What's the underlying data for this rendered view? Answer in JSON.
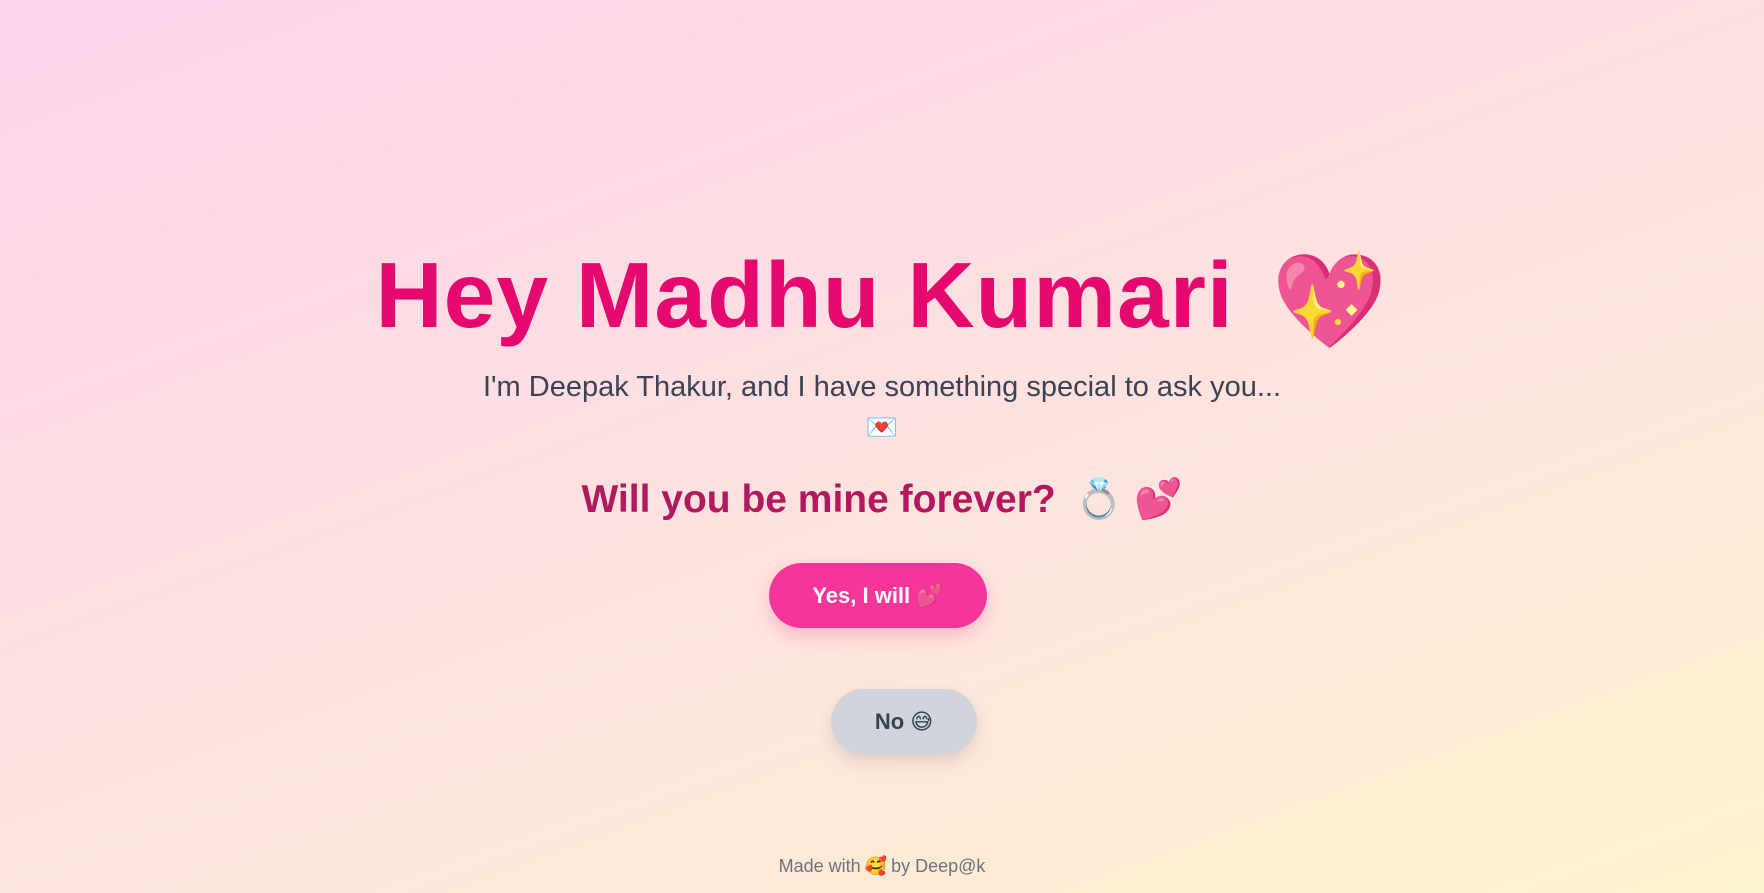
{
  "header": {
    "greeting": "Hey Madhu Kumari",
    "greeting_emoji": "💖"
  },
  "intro": {
    "text": "I'm Deepak Thakur, and I have something special to ask you...",
    "emoji": "💌"
  },
  "question": {
    "text": "Will you be mine forever?",
    "emoji": "💍 💕"
  },
  "buttons": {
    "yes_label": "Yes, I will 💕",
    "no_label": "No 😅"
  },
  "footer": {
    "prefix": "Made with",
    "emoji": "🥰",
    "suffix": "by Deep@k"
  },
  "colors": {
    "title": "#e5086f",
    "question": "#b0195d",
    "yes_button": "#f53599",
    "no_button": "#d1d5db"
  }
}
